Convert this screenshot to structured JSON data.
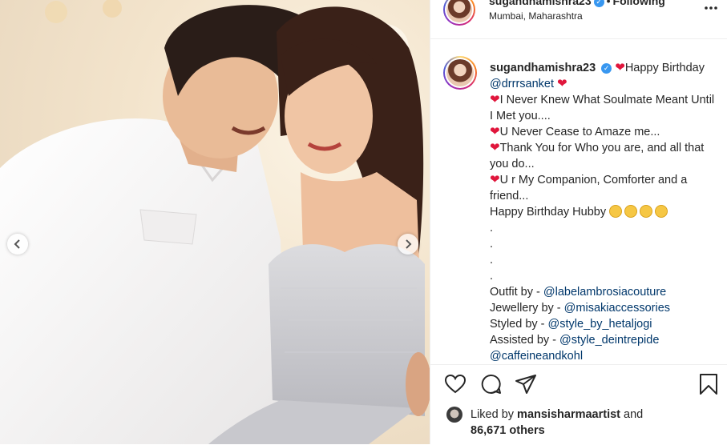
{
  "header": {
    "username": "sugandhamishra23",
    "separator": "•",
    "follow_label": "Following",
    "location": "Mumbai, Maharashtra",
    "more_icon": "more-options-icon"
  },
  "caption": {
    "username": "sugandhamishra23",
    "line1_text": "Happy Birthday ",
    "line1_mention": "@drrrsanket",
    "line2": "I Never Knew What Soulmate Meant Until I Met you....",
    "line3": "U Never Cease to Amaze me...",
    "line4": "Thank You for Who you are, and all that you do...",
    "line5": "U r My Companion, Comforter and a friend...",
    "line6": "Happy Birthday Hubby",
    "dots": [
      ".",
      ".",
      ".",
      "."
    ],
    "credits": [
      {
        "label": "Outfit by - ",
        "mention": "@labelambrosiacouture"
      },
      {
        "label": "Jewellery by - ",
        "mention": "@misakiaccessories"
      },
      {
        "label": "Styled by - ",
        "mention": "@style_by_hetaljogi"
      },
      {
        "label": "Assisted by - ",
        "mention": "@style_deintrepide"
      },
      {
        "label": "",
        "mention": "@caffeineandkohl"
      }
    ]
  },
  "actions": {
    "like_icon": "heart-icon",
    "comment_icon": "comment-icon",
    "share_icon": "share-icon",
    "save_icon": "bookmark-icon"
  },
  "likes": {
    "prefix": "Liked by ",
    "user": "mansisharmaartist",
    "and": " and",
    "count": "86,671",
    "suffix": " others"
  },
  "colors": {
    "mention": "#00376b",
    "heart": "#e0163c",
    "verified": "#3897f0"
  }
}
